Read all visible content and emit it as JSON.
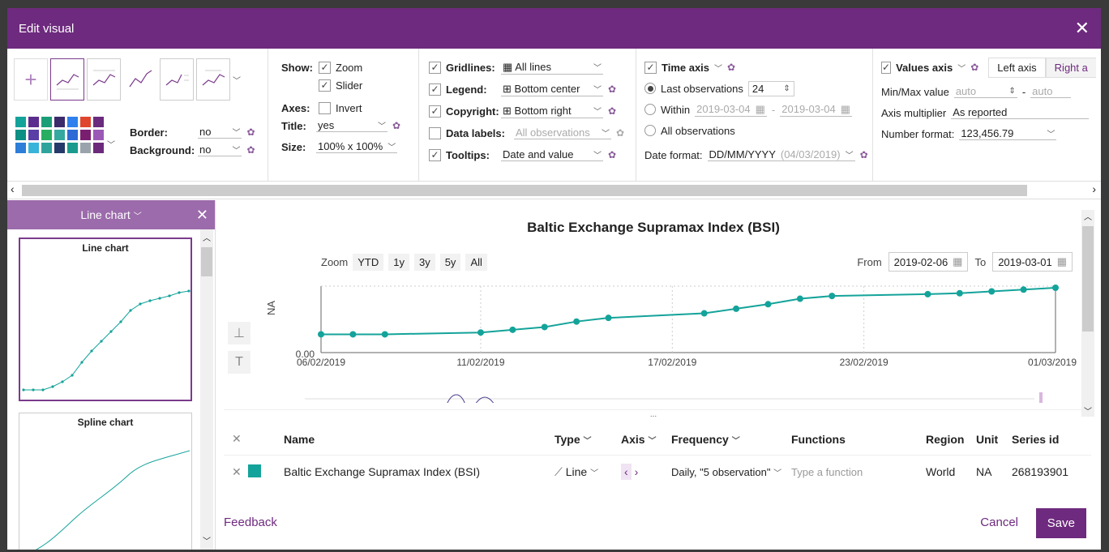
{
  "window": {
    "title": "Edit visual"
  },
  "toolbar": {
    "show_label": "Show:",
    "zoom_label": "Zoom",
    "slider_label": "Slider",
    "axes_label": "Axes:",
    "invert_label": "Invert",
    "title_label": "Title:",
    "title_value": "yes",
    "size_label": "Size:",
    "size_value": "100% x 100%",
    "border_label": "Border:",
    "border_value": "no",
    "background_label": "Background:",
    "background_value": "no",
    "gridlines_label": "Gridlines:",
    "gridlines_value": "All lines",
    "legend_label": "Legend:",
    "legend_value": "Bottom center",
    "copyright_label": "Copyright:",
    "copyright_value": "Bottom right",
    "datalabels_label": "Data labels:",
    "datalabels_value": "All observations",
    "tooltips_label": "Tooltips:",
    "tooltips_value": "Date and value",
    "timeaxis_label": "Time axis",
    "last_obs_label": "Last observations",
    "last_obs_value": "24",
    "within_label": "Within",
    "within_from": "2019-03-04",
    "within_to": "2019-03-04",
    "all_obs_label": "All observations",
    "dateformat_label": "Date format:",
    "dateformat_value": "DD/MM/YYYY",
    "dateformat_example": "(04/03/2019)",
    "valuesaxis_label": "Values axis",
    "left_axis_tab": "Left axis",
    "right_axis_tab": "Right a",
    "minmax_label": "Min/Max value",
    "min_placeholder": "auto",
    "max_placeholder": "auto",
    "multiplier_label": "Axis multiplier",
    "multiplier_value": "As reported",
    "numformat_label": "Number format:",
    "numformat_value": "123,456.79"
  },
  "palette": [
    "#14a39a",
    "#5b2d8e",
    "#1b9e77",
    "#3b2b6b",
    "#2f80ed",
    "#e0452d",
    "#6a2a7e",
    "#0e8f83",
    "#5a3fa6",
    "#27ae60",
    "#35a8a0",
    "#2d6ad6",
    "#7a1f6f",
    "#9b59b6",
    "#2d7ed8",
    "#38b3d9",
    "#2ea39c",
    "#253a6a",
    "#1a9b8e",
    "#9aa3ab",
    "#6b2a7c"
  ],
  "left_pane": {
    "header": "Line chart",
    "cards": [
      {
        "title": "Line chart"
      },
      {
        "title": "Spline chart"
      }
    ]
  },
  "chart_controls": {
    "zoom_label": "Zoom",
    "zoom_buttons": [
      "YTD",
      "1y",
      "3y",
      "5y",
      "All"
    ],
    "from_label": "From",
    "from_date": "2019-02-06",
    "to_label": "To",
    "to_date": "2019-03-01"
  },
  "chart_data": {
    "type": "line",
    "title": "Baltic Exchange Supramax Index (BSI)",
    "ylabel": "NA",
    "ytick": "0.00",
    "xticks": [
      "06/02/2019",
      "11/02/2019",
      "17/02/2019",
      "23/02/2019",
      "01/03/2019"
    ],
    "series": [
      {
        "name": "Baltic Exchange Supramax Index (BSI)",
        "color": "#14a39a",
        "x": [
          "2019-02-06",
          "2019-02-07",
          "2019-02-08",
          "2019-02-11",
          "2019-02-12",
          "2019-02-13",
          "2019-02-14",
          "2019-02-15",
          "2019-02-18",
          "2019-02-19",
          "2019-02-20",
          "2019-02-21",
          "2019-02-22",
          "2019-02-25",
          "2019-02-26",
          "2019-02-27",
          "2019-02-28",
          "2019-03-01"
        ],
        "y": [
          0.2,
          0.2,
          0.2,
          0.22,
          0.25,
          0.28,
          0.34,
          0.38,
          0.43,
          0.48,
          0.53,
          0.59,
          0.62,
          0.64,
          0.65,
          0.67,
          0.69,
          0.71
        ]
      }
    ]
  },
  "table": {
    "headers": {
      "name": "Name",
      "type": "Type",
      "axis": "Axis",
      "frequency": "Frequency",
      "functions": "Functions",
      "region": "Region",
      "unit": "Unit",
      "series_id": "Series id"
    },
    "more_indicator": "...",
    "rows": [
      {
        "name": "Baltic Exchange Supramax Index (BSI)",
        "color": "#14a39a",
        "type": "Line",
        "frequency": "Daily, \"5 observation\"",
        "functions_placeholder": "Type a function",
        "region": "World",
        "unit": "NA",
        "series_id": "268193901"
      }
    ]
  },
  "footer": {
    "feedback": "Feedback",
    "cancel": "Cancel",
    "save": "Save"
  }
}
